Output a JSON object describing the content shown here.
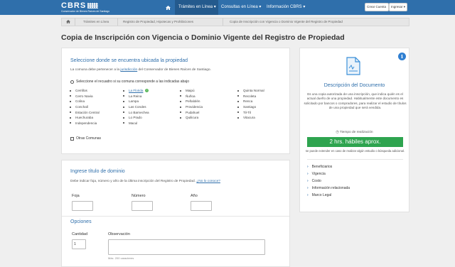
{
  "logo": {
    "text": "CBRS",
    "subtitle": "Conservador de Bienes Raíces de Santiago"
  },
  "navbar": {
    "tramites": "Trámites en Línea ▾",
    "consultas": "Consultas en Línea ▾",
    "informacion": "Información CBRS ▾",
    "crear_cuenta": "Crear Cuenta",
    "ingresar": "Ingresar ▾"
  },
  "breadcrumb": [
    "Trámites en Línea",
    "Registro de Propiedad, Hipotecas y Prohibiciones",
    "Copia de Inscripción con Vigencia o Dominio Vigente del Registro de Propiedad"
  ],
  "page_title": "Copia de Inscripción con Vigencia o Dominio Vigente del Registro de Propiedad",
  "ubicacion": {
    "title": "Seleccione donde se encuentra ubicada la propiedad",
    "desc_pre": "La comuna debe pertenecer a la",
    "desc_link": "jurisdicción",
    "desc_post": "del Conservador de Bienes Raíces de Santiago.",
    "radio_label": "Seleccione el recuadro si su comuna corresponde a las indicadas abajo",
    "comunas": [
      [
        "Cerrillos",
        "Cerro Navia",
        "Colina",
        "Conchalí",
        "Estación Central",
        "Huechuraba",
        "Independencia"
      ],
      [
        "La Florida",
        "La Reina",
        "Lampa",
        "Las Condes",
        "Lo Barnechea",
        "Lo Prado",
        "Macul"
      ],
      [
        "Maipú",
        "Ñuñoa",
        "Peñalolén",
        "Providencia",
        "Pudahuel",
        "Quilicura"
      ],
      [
        "Quinta Normal",
        "Recoleta",
        "Renca",
        "Santiago",
        "Til-Til",
        "Vitacura"
      ]
    ],
    "otras": "Otras Comunas"
  },
  "titulo": {
    "title": "Ingrese título de dominio",
    "desc": "Debe indicar foja, número y año de la última inscripción del Registro de Propiedad.",
    "desc_link": "¿No lo conoce?",
    "foja": "Foja",
    "numero": "Número",
    "anio": "Año"
  },
  "opciones": {
    "title": "Opciones",
    "cantidad_label": "Cantidad",
    "cantidad_value": "1",
    "observacion_label": "Observación",
    "max_chars": "Máx. 200 caracteres"
  },
  "documento": {
    "title": "Descripción del Documento",
    "body": "Es una copia autorizada de una inscripción, que indica quién es el actual dueño de una propiedad. Habitualmente este documento es solicitado por bancos o compradores, para realizar el estudio de títulos de una propiedad que será vendida.",
    "tiempo_label": "Tiempo de realización",
    "tiempo_value": "2 hrs. hábiles aprox.",
    "tiempo_note": "se puede extender en caso de realizar algún estudio o búsqueda adicional.",
    "links": [
      "Beneficiarios",
      "Vigencia",
      "Costo",
      "Información relacionada",
      "Marco Legal"
    ]
  },
  "colors": {
    "brand": "#2f6fab",
    "green": "#2ea44f",
    "info": "#2f7fd1"
  }
}
